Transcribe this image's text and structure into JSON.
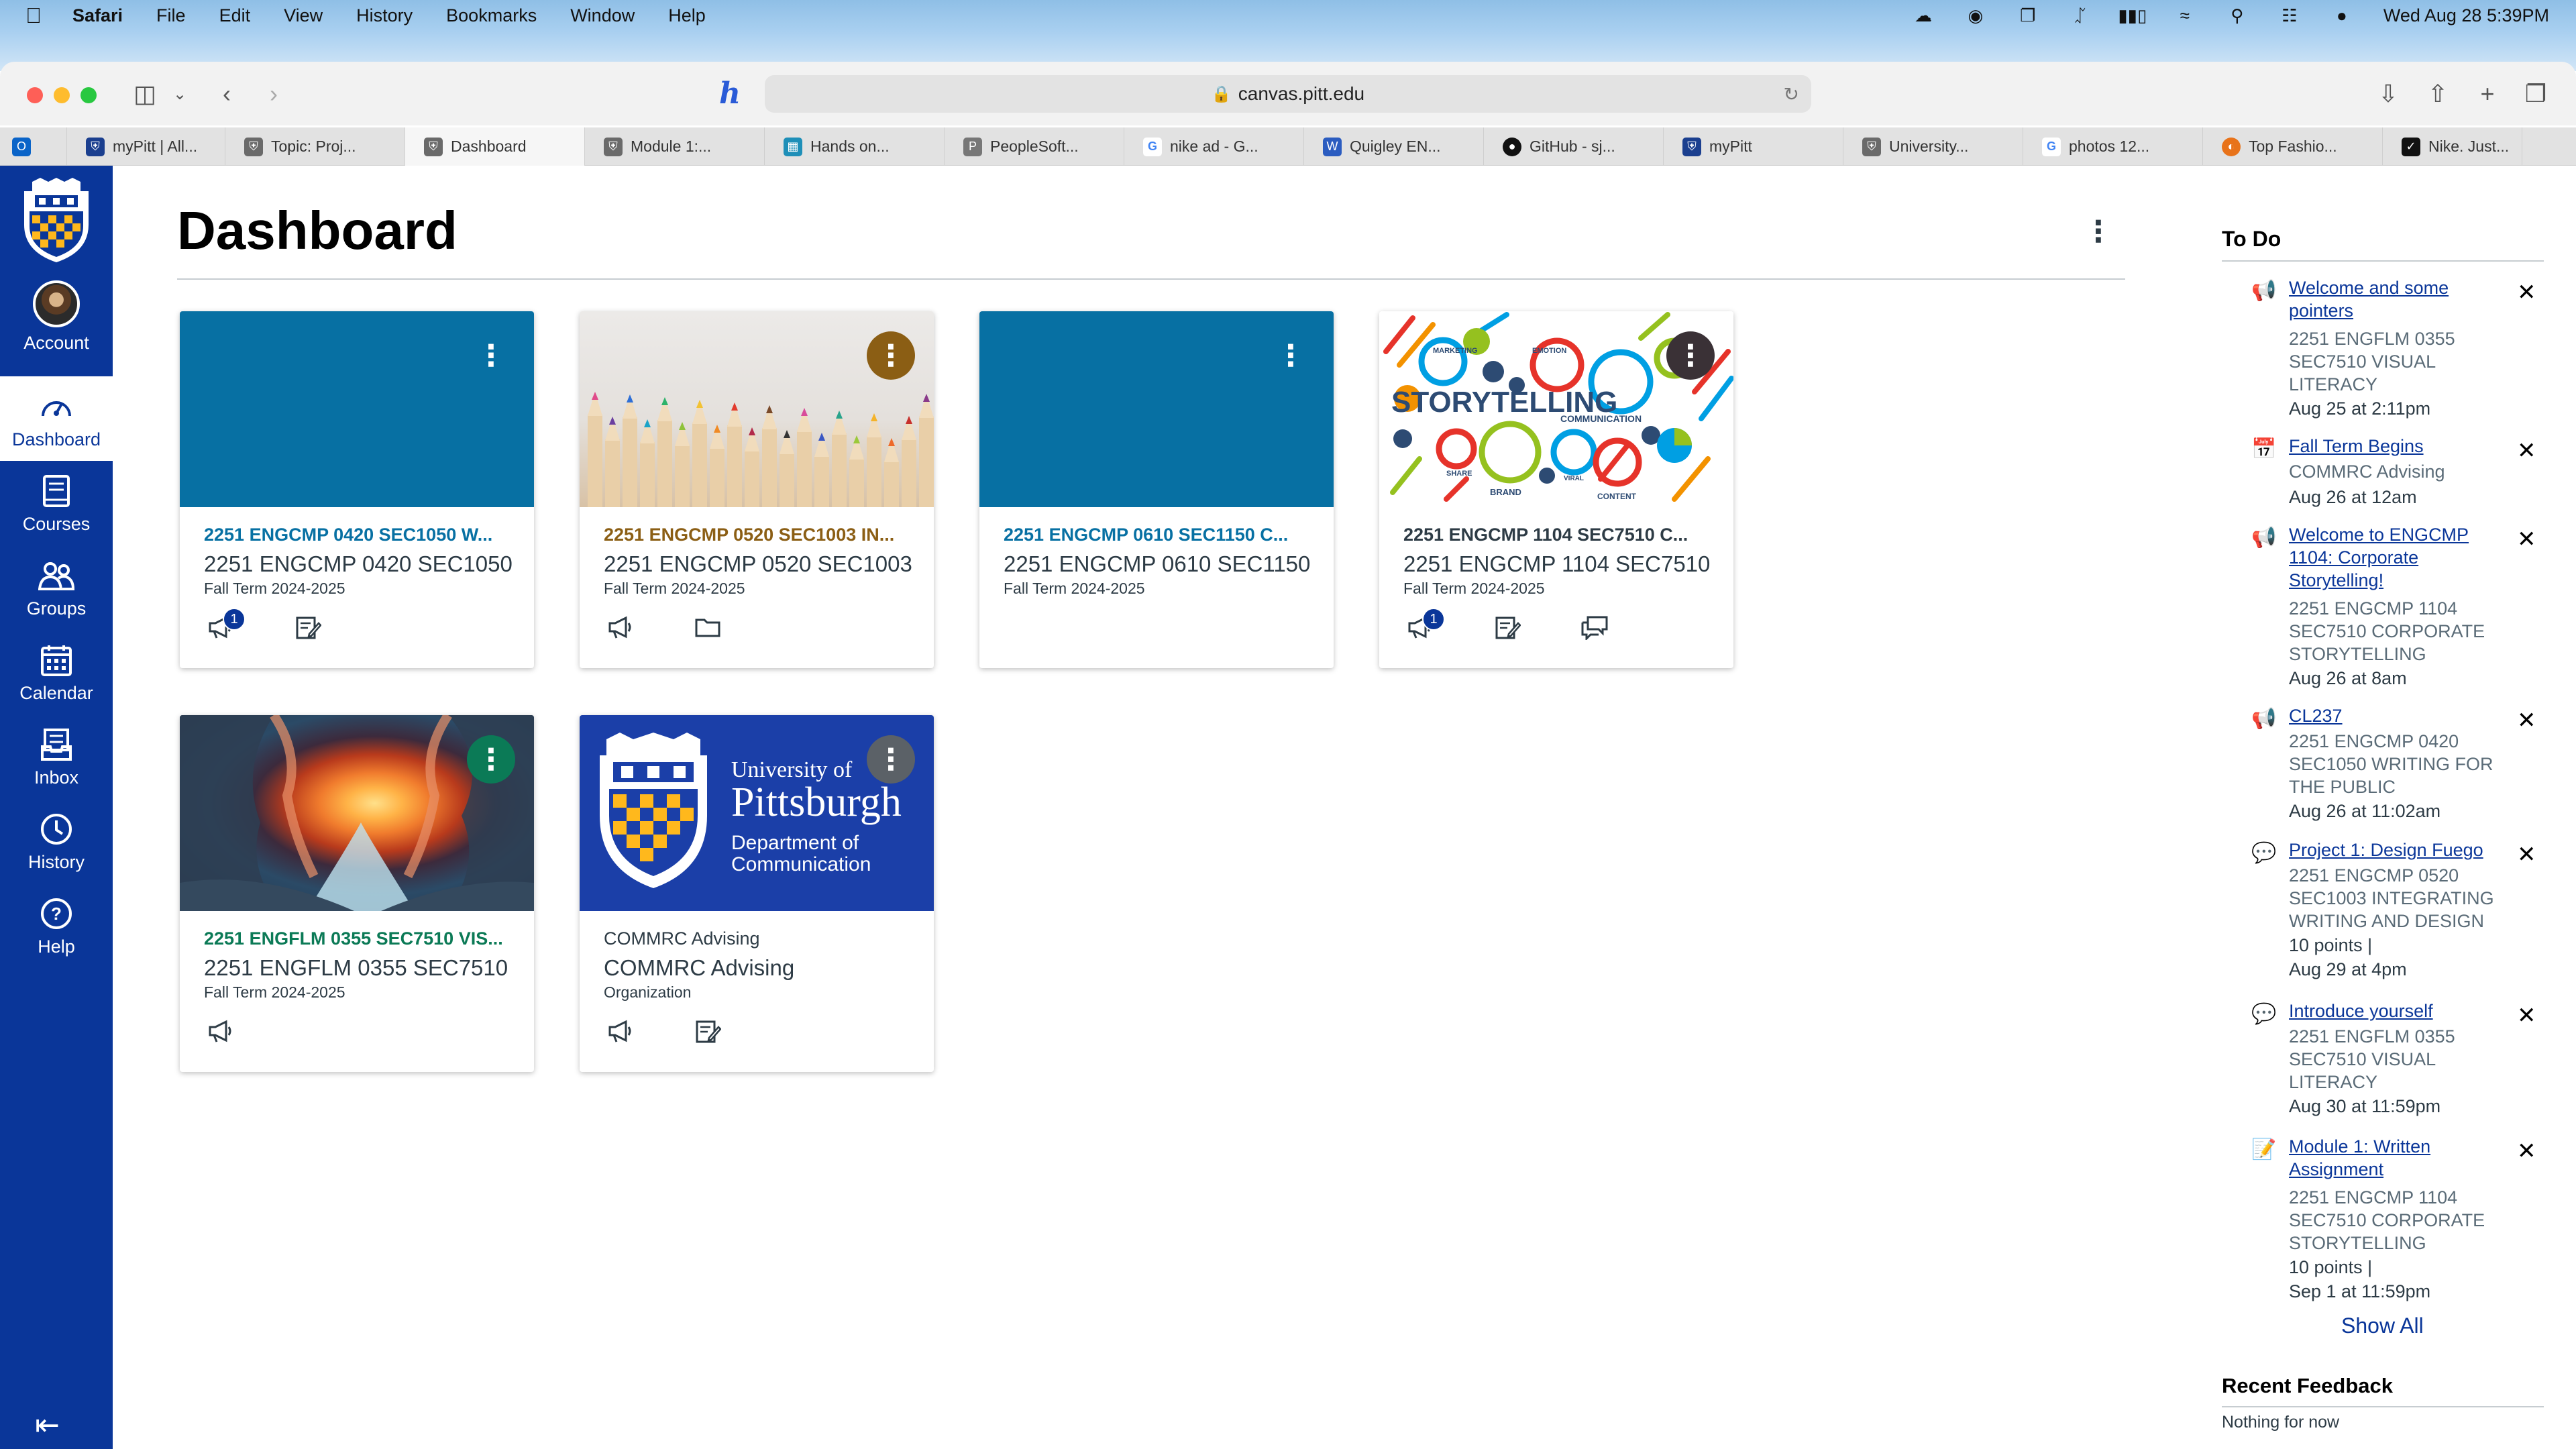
{
  "menubar": {
    "app": "Safari",
    "items": [
      "File",
      "Edit",
      "View",
      "History",
      "Bookmarks",
      "Window",
      "Help"
    ],
    "datetime": "Wed Aug 28  5:39PM"
  },
  "browser": {
    "url": "canvas.pitt.edu",
    "tabs": [
      {
        "label": "myPitt | All...",
        "color": "#1b3f8f"
      },
      {
        "label": "Topic: Proj...",
        "color": "#6a6a6a"
      },
      {
        "label": "Dashboard",
        "color": "#6a6a6a"
      },
      {
        "label": "Module 1:...",
        "color": "#6a6a6a"
      },
      {
        "label": "Hands on...",
        "color": "#1e8fb8"
      },
      {
        "label": "PeopleSoft...",
        "color": "#777777"
      },
      {
        "label": "nike ad - G...",
        "color": "#4285f4"
      },
      {
        "label": "Quigley EN...",
        "color": "#2b5cc0"
      },
      {
        "label": "GitHub - sj...",
        "color": "#111111"
      },
      {
        "label": "myPitt",
        "color": "#1b3f8f"
      },
      {
        "label": "University...",
        "color": "#6a6a6a"
      },
      {
        "label": "photos 12...",
        "color": "#4285f4"
      },
      {
        "label": "Top Fashio...",
        "color": "#e8731a"
      },
      {
        "label": "Nike. Just...",
        "color": "#111111"
      }
    ]
  },
  "nav": {
    "account": "Account",
    "dashboard": "Dashboard",
    "courses": "Courses",
    "groups": "Groups",
    "calendar": "Calendar",
    "inbox": "Inbox",
    "history": "History",
    "help": "Help"
  },
  "page": {
    "title": "Dashboard"
  },
  "cards": [
    {
      "code": "2251 ENGCMP 0420 SEC1050 W...",
      "name": "2251 ENGCMP 0420 SEC1050",
      "term": "Fall Term 2024-2025",
      "color": "#0770a3",
      "badge": "1"
    },
    {
      "code": "2251 ENGCMP 0520 SEC1003 IN...",
      "name": "2251 ENGCMP 0520 SEC1003",
      "term": "Fall Term 2024-2025",
      "color": "#8b5e14"
    },
    {
      "code": "2251 ENGCMP 0610 SEC1150 C...",
      "name": "2251 ENGCMP 0610 SEC1150",
      "term": "Fall Term 2024-2025",
      "color": "#0770a3"
    },
    {
      "code": "2251 ENGCMP 1104 SEC7510 C...",
      "name": "2251 ENGCMP 1104 SEC7510",
      "term": "Fall Term 2024-2025",
      "color": "#2d3b45",
      "badge": "1"
    },
    {
      "code": "2251 ENGFLM 0355 SEC7510 VIS...",
      "name": "2251 ENGFLM 0355 SEC7510",
      "term": "Fall Term 2024-2025",
      "color": "#0b7a56"
    },
    {
      "code": "COMMRC Advising",
      "name": "COMMRC Advising",
      "term": "Organization",
      "color": "#2d3b45"
    }
  ],
  "storytelling": {
    "headline": "STORYTELLING",
    "w1": "MARKETING",
    "w2": "EMOTION",
    "w3": "COMMUNICATION",
    "w4": "SHARE",
    "w5": "BRAND",
    "w6": "VIRAL",
    "w7": "CONTENT"
  },
  "pitt_logo": {
    "line1": "University of",
    "line2": "Pittsburgh",
    "line3": "Department of",
    "line4": "Communication"
  },
  "todo": {
    "heading": "To Do",
    "items": [
      {
        "title": "Welcome and some pointers",
        "course": "2251 ENGFLM 0355 SEC7510 VISUAL LITERACY",
        "date": "Aug 25 at 2:11pm"
      },
      {
        "title": "Fall Term Begins",
        "course": "COMMRC Advising",
        "date": "Aug 26 at 12am"
      },
      {
        "title": "Welcome to ENGCMP 1104: Corporate Storytelling!",
        "course": "2251 ENGCMP 1104 SEC7510 CORPORATE STORYTELLING",
        "date": "Aug 26 at 8am"
      },
      {
        "title": "CL237",
        "course": "2251 ENGCMP 0420 SEC1050 WRITING FOR THE PUBLIC",
        "date": "Aug 26 at 11:02am"
      },
      {
        "title": "Project 1: Design Fuego",
        "course": "2251 ENGCMP 0520 SEC1003 INTEGRATING WRITING AND DESIGN",
        "points": "10 points  |",
        "date": "Aug 29 at 4pm"
      },
      {
        "title": "Introduce yourself",
        "course": "2251 ENGFLM 0355 SEC7510 VISUAL LITERACY",
        "date": "Aug 30 at 11:59pm"
      },
      {
        "title": "Module 1: Written Assignment",
        "course": "2251 ENGCMP 1104 SEC7510 CORPORATE STORYTELLING",
        "points": "10 points  |",
        "date": "Sep 1 at 11:59pm"
      }
    ],
    "show_all": "Show All"
  },
  "feedback": {
    "heading": "Recent Feedback",
    "empty": "Nothing for now"
  }
}
